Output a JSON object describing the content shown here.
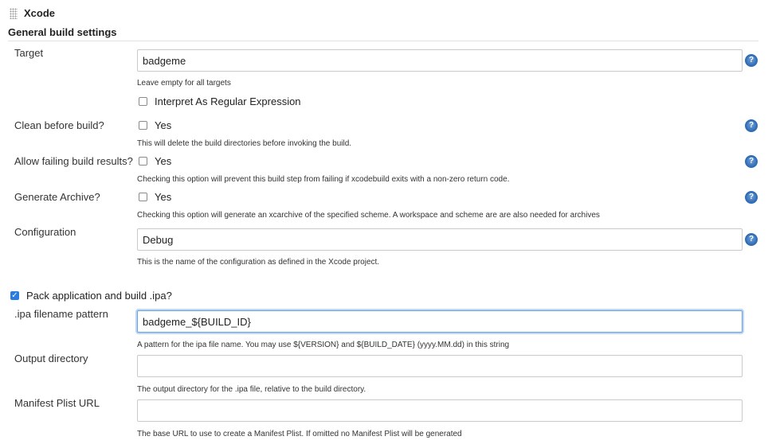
{
  "header": {
    "step_title": "Xcode",
    "section_title": "General build settings"
  },
  "fields": {
    "target": {
      "label": "Target",
      "value": "badgeme",
      "description": "Leave empty for all targets",
      "regex_label": "Interpret As Regular Expression",
      "regex_checked": false
    },
    "clean_before_build": {
      "label": "Clean before build?",
      "checkbox_label": "Yes",
      "checked": false,
      "description": "This will delete the build directories before invoking the build."
    },
    "allow_failing": {
      "label": "Allow failing build results?",
      "checkbox_label": "Yes",
      "checked": false,
      "description": "Checking this option will prevent this build step from failing if xcodebuild exits with a non-zero return code."
    },
    "generate_archive": {
      "label": "Generate Archive?",
      "checkbox_label": "Yes",
      "checked": false,
      "description": "Checking this option will generate an xcarchive of the specified scheme. A workspace and scheme are are also needed for archives"
    },
    "configuration": {
      "label": "Configuration",
      "value": "Debug",
      "description": "This is the name of the configuration as defined in the Xcode project."
    },
    "pack_ipa": {
      "label": "Pack application and build .ipa?",
      "checked": true
    },
    "ipa_pattern": {
      "label": ".ipa filename pattern",
      "value": "badgeme_${BUILD_ID}",
      "description": "A pattern for the ipa file name. You may use ${VERSION} and ${BUILD_DATE} (yyyy.MM.dd) in this string"
    },
    "output_directory": {
      "label": "Output directory",
      "value": "",
      "description": "The output directory for the .ipa file, relative to the build directory."
    },
    "manifest_plist_url": {
      "label": "Manifest Plist URL",
      "value": "",
      "description": "The base URL to use to create a Manifest Plist. If omitted no Manifest Plist will be generated"
    }
  },
  "help_icon_glyph": "?",
  "colors": {
    "accent": "#2a7ce0",
    "help": "#2f6db8",
    "focus": "#6aa2e0"
  }
}
